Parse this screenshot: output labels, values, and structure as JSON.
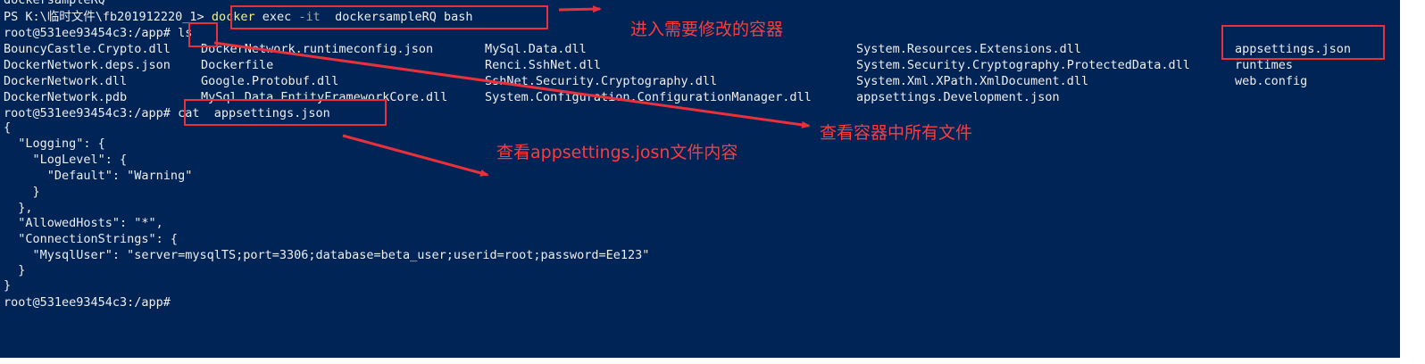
{
  "terminal": {
    "lines": {
      "l0": "dockersampleRQ",
      "l1_prompt": "PS K:\\临时文件\\fb201912220_1>",
      "l1_cmd": "docker",
      "l1_sub": "exec",
      "l1_flag": "-it",
      "l1_rest": "dockersampleRQ bash",
      "l2_prompt": "root@531ee93454c3:/app#",
      "l2_cmd": "ls",
      "l7_prompt": "root@531ee93454c3:/app#",
      "l7_cmd": "cat  appsettings.json",
      "json": [
        "{",
        "  \"Logging\": {",
        "    \"LogLevel\": {",
        "      \"Default\": \"Warning\"",
        "    }",
        "  },",
        "  \"AllowedHosts\": \"*\",",
        "  \"ConnectionStrings\": {",
        "    \"MysqlUser\": \"server=mysqlTS;port=3306;database=beta_user;userid=root;password=Ee123\"",
        "  }",
        "}"
      ],
      "final_prompt": "root@531ee93454c3:/app#"
    },
    "ls_columns": [
      [
        "BouncyCastle.Crypto.dll",
        "DockerNetwork.deps.json",
        "DockerNetwork.dll",
        "DockerNetwork.pdb"
      ],
      [
        "DockerNetwork.runtimeconfig.json",
        "Dockerfile",
        "Google.Protobuf.dll",
        "MySql.Data.EntityFrameworkCore.dll"
      ],
      [
        "MySql.Data.dll",
        "Renci.SshNet.dll",
        "SshNet.Security.Cryptography.dll",
        "System.Configuration.ConfigurationManager.dll"
      ],
      [
        "System.Resources.Extensions.dll",
        "System.Security.Cryptography.ProtectedData.dll",
        "System.Xml.XPath.XmlDocument.dll",
        "appsettings.Development.json"
      ],
      [
        "appsettings.json",
        "runtimes",
        "web.config",
        ""
      ]
    ]
  },
  "annotations": {
    "enter_container": "进入需要修改的容器",
    "view_all_files": "查看容器中所有文件",
    "view_appsettings": "查看appsettings.josn文件内容"
  },
  "colors": {
    "background": "#012456",
    "text": "#eeedf0",
    "command": "#f2f18f",
    "flag": "#a9a9a9",
    "annotation": "#ff3b3b"
  }
}
